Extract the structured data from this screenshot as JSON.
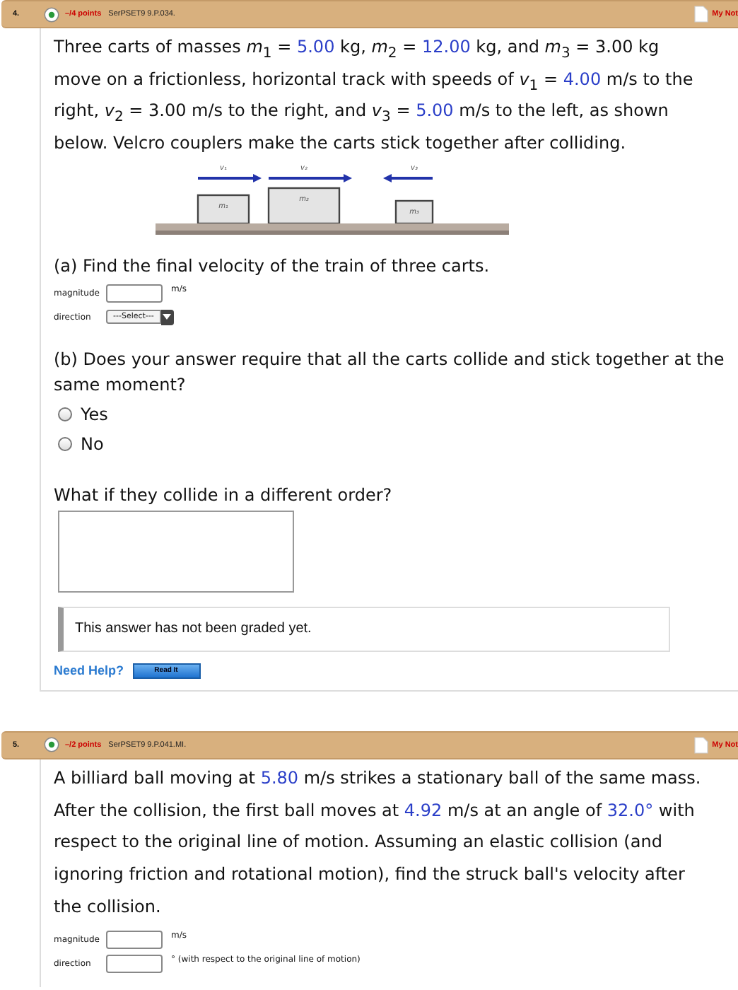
{
  "questions": [
    {
      "number": "4.",
      "points": "–/4 points",
      "code": "SerPSET9 9.P.034.",
      "notes": "My Not",
      "problem": [
        {
          "kind": "text",
          "t": "Three carts of masses "
        },
        {
          "kind": "text",
          "t": "*m*$_{1}$ = "
        },
        {
          "kind": "value",
          "t": "5.00"
        },
        {
          "kind": "text",
          "t": " kg, *m*$_{2}$ = "
        },
        {
          "kind": "value",
          "t": "12.00"
        },
        {
          "kind": "text",
          "t": " kg, and *m*$_{3}$ = 3.00 kg move on a frictionless, horizontal track with speeds of *v*$_{1}$ = "
        },
        {
          "kind": "value",
          "t": "4.00"
        },
        {
          "kind": "text",
          "t": " m/s to the right, *v*$_{2}$ = 3.00 m/s to the right, and *v*$_{3}$ = "
        },
        {
          "kind": "value",
          "t": "5.00"
        },
        {
          "kind": "text",
          "t": " m/s to the left, as shown below. Velcro couplers make the carts stick together after colliding."
        }
      ],
      "diagram": {
        "carts": [
          {
            "label": "m₁",
            "speed_label": "v₁"
          },
          {
            "label": "m₂",
            "speed_label": "v₂"
          },
          {
            "label": "m₃",
            "speed_label": "v₃"
          }
        ]
      },
      "parts": [
        {
          "kind": "fields",
          "prompt": "(a) Find the final velocity of the train of three carts.",
          "fields": [
            {
              "label": "magnitude",
              "kind": "input",
              "unit": "m/s"
            },
            {
              "label": "direction",
              "kind": "select",
              "value": "---Select---"
            }
          ]
        },
        {
          "kind": "radio",
          "prompt": "(b) Does your answer require that all the carts collide and stick together at the same moment?",
          "options": [
            {
              "label": "Yes",
              "selected": false
            },
            {
              "label": "No",
              "selected": false
            }
          ]
        },
        {
          "kind": "essay",
          "prompt": "What if they collide in a different order?",
          "status": "This answer has not been graded yet."
        }
      ],
      "help": {
        "label": "Need Help?",
        "button": "Read It"
      }
    },
    {
      "number": "5.",
      "points": "–/2 points",
      "code": "SerPSET9 9.P.041.MI.",
      "notes": "My Not",
      "problem": [
        {
          "kind": "text",
          "t": "A billiard ball moving at "
        },
        {
          "kind": "value",
          "t": "5.80"
        },
        {
          "kind": "text",
          "t": " m/s strikes a stationary ball of the same mass. After the collision, the first ball moves at "
        },
        {
          "kind": "value",
          "t": "4.92"
        },
        {
          "kind": "text",
          "t": " m/s at an angle of "
        },
        {
          "kind": "value",
          "t": "32.0°"
        },
        {
          "kind": "text",
          "t": " with respect to the original line of motion. Assuming an elastic collision (and ignoring friction and rotational motion), find the struck ball's velocity after the collision."
        }
      ],
      "parts": [
        {
          "kind": "fields",
          "fields": [
            {
              "label": "magnitude",
              "kind": "input",
              "unit": "m/s"
            },
            {
              "label": "direction",
              "kind": "input",
              "unit": "° (with respect to the original line of motion)"
            }
          ]
        }
      ]
    }
  ]
}
